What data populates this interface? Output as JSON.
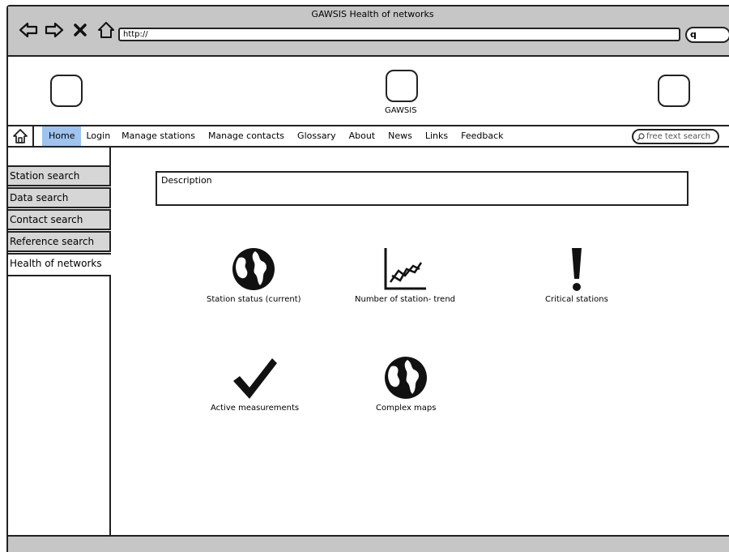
{
  "window": {
    "title": "GAWSIS Health of networks",
    "address": "http://"
  },
  "header": {
    "center_logo_label": "GAWSIS"
  },
  "menu": {
    "items": [
      "Home",
      "Login",
      "Manage stations",
      "Manage contacts",
      "Glossary",
      "About",
      "News",
      "Links",
      "Feedback"
    ],
    "active": "Home",
    "search_placeholder": "free text search"
  },
  "sidebar": {
    "items": [
      "Station search",
      "Data search",
      "Contact search",
      "Reference search"
    ],
    "active_item": "Health of networks"
  },
  "main": {
    "description_label": "Description",
    "tiles": [
      {
        "label": "Station status (current)",
        "icon": "globe-icon"
      },
      {
        "label": "Number of station- trend",
        "icon": "trend-chart-icon"
      },
      {
        "label": "Critical stations",
        "icon": "exclamation-icon"
      },
      {
        "label": "Active measurements",
        "icon": "checkmark-icon"
      },
      {
        "label": "Complex maps",
        "icon": "globe-icon"
      }
    ]
  }
}
